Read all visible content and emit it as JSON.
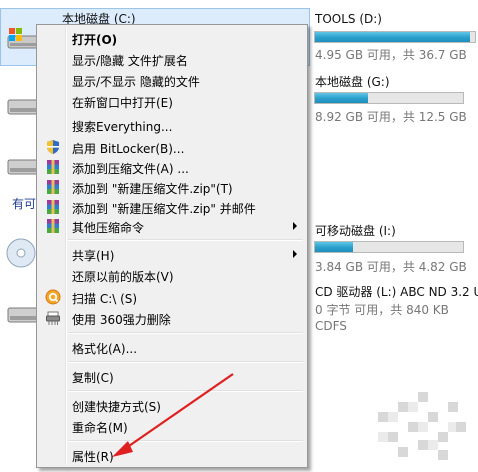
{
  "drives": [
    {
      "name": "本地磁盘 (C:)",
      "space": "",
      "fill": 0,
      "icon": "windows-drive-icon"
    },
    {
      "name": "TOOLS (D:)",
      "space": "4.95 GB 可用，共 36.7 GB",
      "fill": 0.87,
      "icon": "hard-drive-icon"
    },
    {
      "name": "本地磁盘 (G:)",
      "space": "8.92 GB 可用，共 12.5 GB",
      "fill": 0.29,
      "icon": "hard-drive-icon"
    },
    {
      "name": "可移动磁盘 (I:)",
      "space": "3.84 GB 可用，共 4.82 GB",
      "fill": 0.2,
      "icon": "removable-drive-icon"
    },
    {
      "name": "CD 驱动器 (L:) ABC ND 3.2 U",
      "space": "0 字节 可用，共 840 KB",
      "fill": 0,
      "icon": "cd-drive-icon",
      "fs": "CDFS"
    }
  ],
  "section_label": "有可",
  "menu": {
    "open": "打开(O)",
    "show_hide_ext": "显示/隐藏 文件扩展名",
    "show_hide_hidden": "显示/不显示 隐藏的文件",
    "open_new_window": "在新窗口中打开(E)",
    "search_everything": "搜索Everything...",
    "bitlocker": "启用 BitLocker(B)...",
    "add_archive": "添加到压缩文件(A) ...",
    "add_zip": "添加到 \"新建压缩文件.zip\"(T)",
    "add_zip_mail": "添加到 \"新建压缩文件.zip\" 并邮件",
    "other_compress": "其他压缩命令",
    "share": "共享(H)",
    "restore": "还原以前的版本(V)",
    "scan": "扫描 C:\\ (S)",
    "delete_360": "使用 360强力删除",
    "format": "格式化(A)...",
    "copy": "复制(C)",
    "create_shortcut": "创建快捷方式(S)",
    "rename": "重命名(M)",
    "properties": "属性(R)"
  },
  "colors": {
    "accent_arrow": "#e02020",
    "bar_fill": "#2a9fcc",
    "selection": "#dcecfc"
  }
}
